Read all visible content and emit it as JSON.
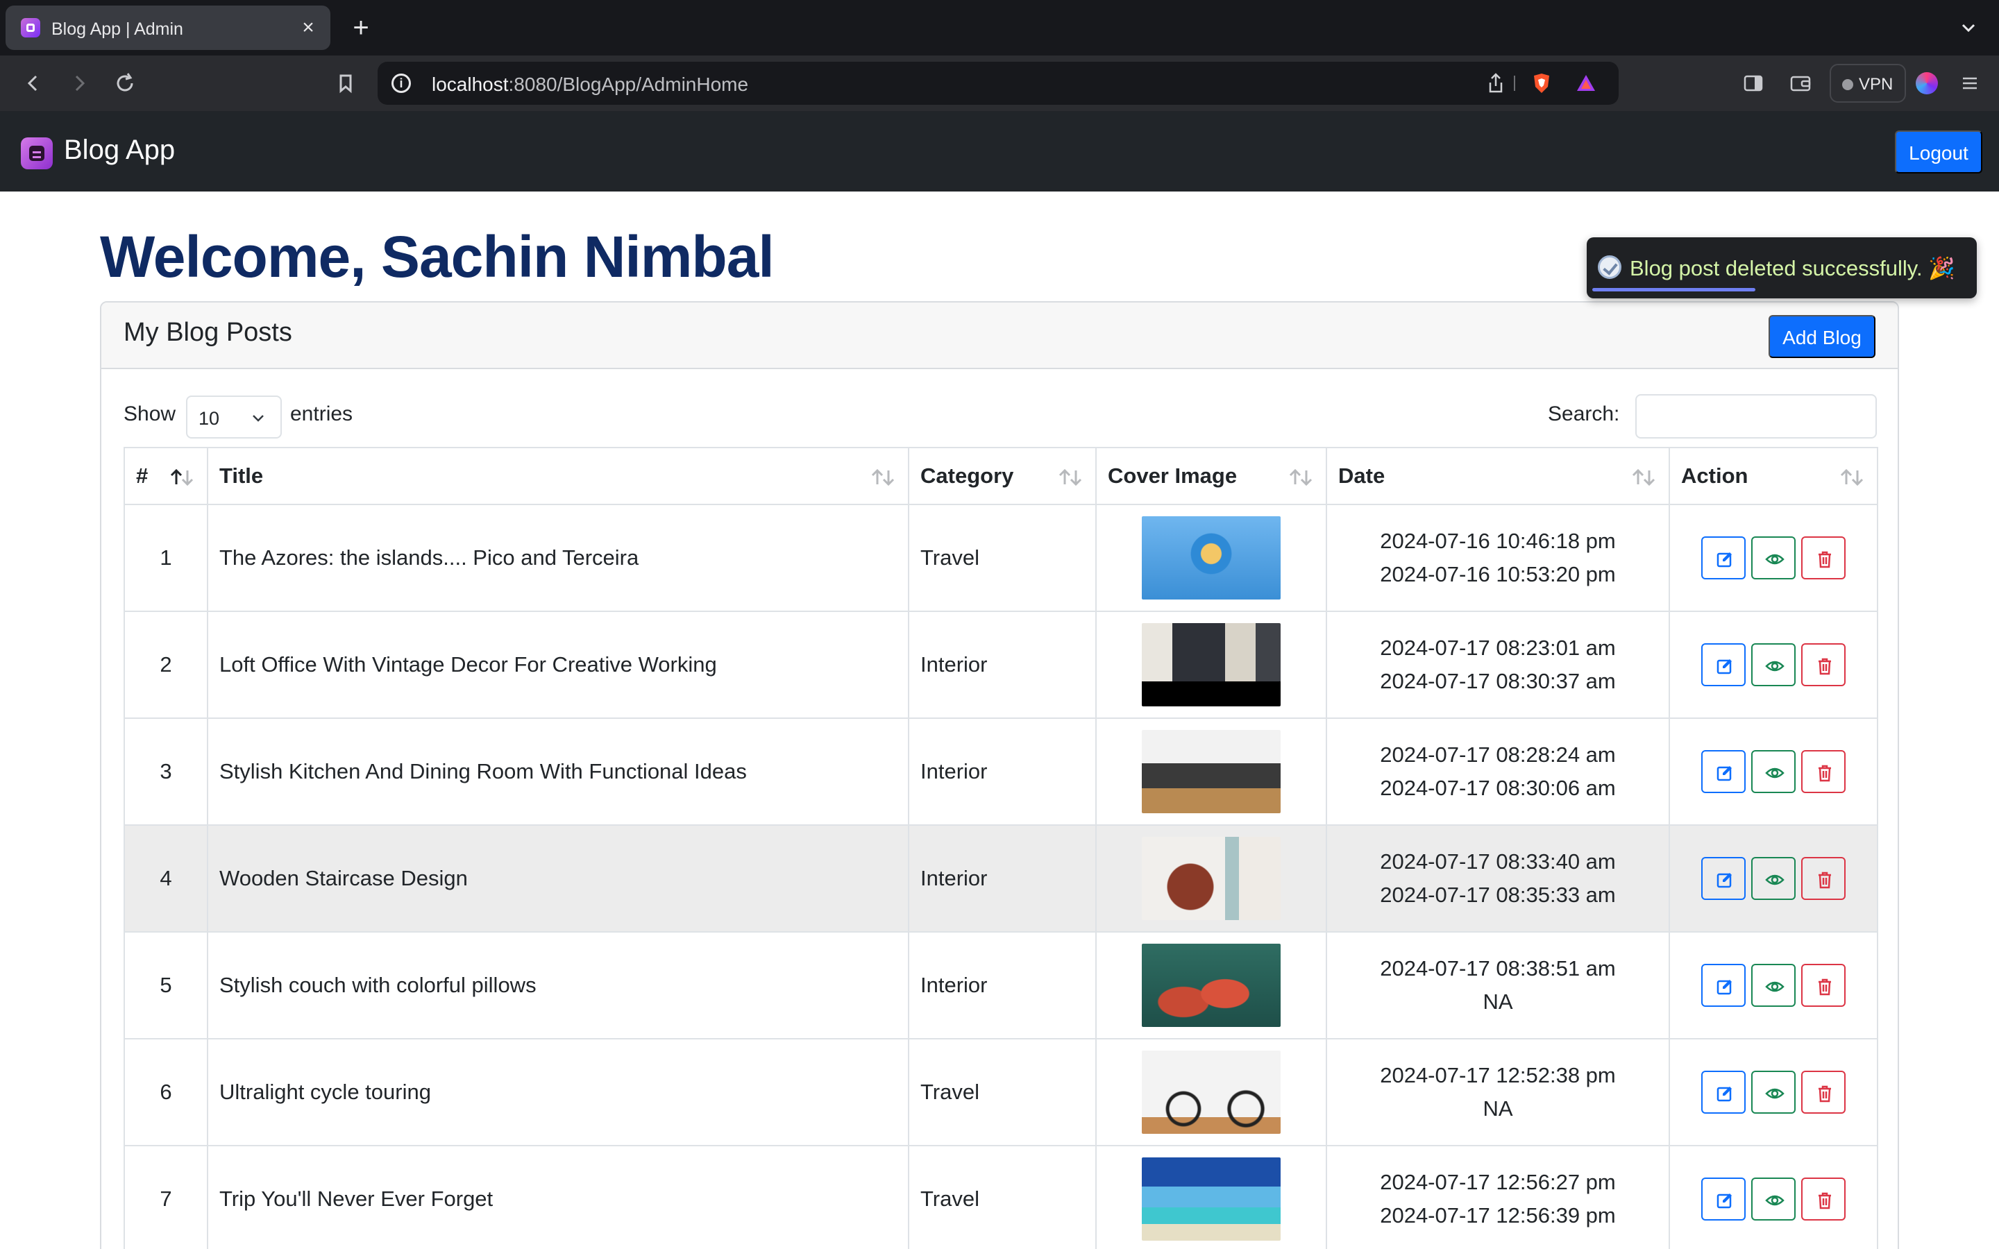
{
  "browser": {
    "tab_title": "Blog App | Admin",
    "url_host": "localhost",
    "url_path": ":8080/BlogApp/AdminHome",
    "vpn_label": "VPN"
  },
  "navbar": {
    "brand": "Blog App",
    "logout_label": "Logout"
  },
  "page": {
    "welcome": "Welcome, Sachin Nimbal"
  },
  "toast": {
    "message": "Blog post deleted successfully. 🎉",
    "progress": 0.43
  },
  "card": {
    "title": "My Blog Posts",
    "add_label": "Add Blog"
  },
  "controls": {
    "show_label": "Show",
    "entries_value": "10",
    "entries_label": "entries",
    "search_label": "Search:",
    "search_value": ""
  },
  "table": {
    "headers": [
      "#",
      "Title",
      "Category",
      "Cover Image",
      "Date",
      "Action"
    ],
    "rows": [
      {
        "num": "1",
        "title": "The Azores: the islands.... Pico and Terceira",
        "category": "Travel",
        "created": "2024-07-16 10:46:18 pm",
        "updated": "2024-07-16 10:53:20 pm"
      },
      {
        "num": "2",
        "title": "Loft Office With Vintage Decor For Creative Working",
        "category": "Interior",
        "created": "2024-07-17 08:23:01 am",
        "updated": "2024-07-17 08:30:37 am"
      },
      {
        "num": "3",
        "title": "Stylish Kitchen And Dining Room With Functional Ideas",
        "category": "Interior",
        "created": "2024-07-17 08:28:24 am",
        "updated": "2024-07-17 08:30:06 am"
      },
      {
        "num": "4",
        "title": "Wooden Staircase Design",
        "category": "Interior",
        "created": "2024-07-17 08:33:40 am",
        "updated": "2024-07-17 08:35:33 am"
      },
      {
        "num": "5",
        "title": "Stylish couch with colorful pillows",
        "category": "Interior",
        "created": "2024-07-17 08:38:51 am",
        "updated": "NA"
      },
      {
        "num": "6",
        "title": "Ultralight cycle touring",
        "category": "Travel",
        "created": "2024-07-17 12:52:38 pm",
        "updated": "NA"
      },
      {
        "num": "7",
        "title": "Trip You'll Never Ever Forget",
        "category": "Travel",
        "created": "2024-07-17 12:56:27 pm",
        "updated": "2024-07-17 12:56:39 pm"
      }
    ]
  },
  "colors": {
    "primary": "#0d6efd",
    "success": "#198754",
    "danger": "#dc3545",
    "heading": "#0f2a63",
    "navbar": "#212529"
  }
}
